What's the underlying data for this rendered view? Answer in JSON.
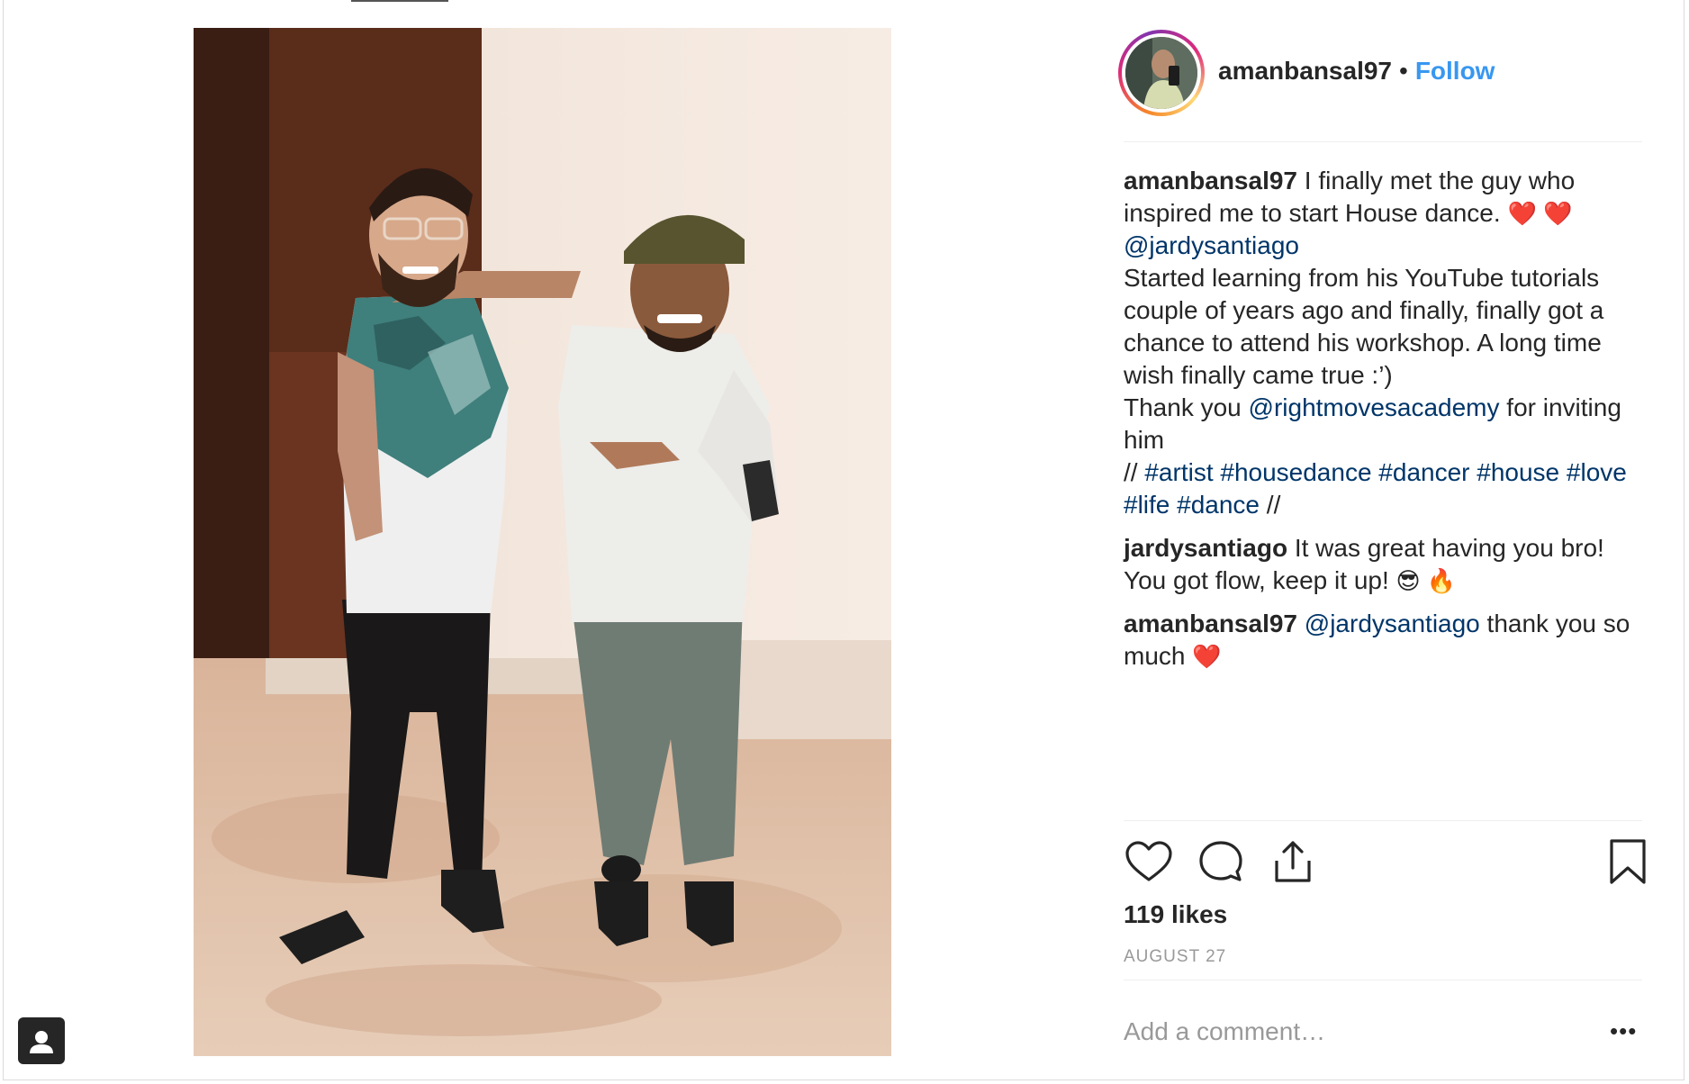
{
  "post": {
    "image_alt": "Two men posing together in a dance studio",
    "user_tag_icon": "person-tag-icon"
  },
  "header": {
    "username": "amanbansal97",
    "separator": "•",
    "follow_label": "Follow"
  },
  "caption": {
    "username": "amanbansal97",
    "text_1": "I finally met the guy who inspired me to start House dance.",
    "hearts": "❤️ ❤️",
    "mention": "@jardysantiago",
    "text_2": "Started learning from his YouTube tutorials couple of years ago and finally, finally got a chance to attend his workshop. A long time wish finally came true :’)",
    "thanks_pre": "Thank you",
    "thanks_mention": "@rightmovesacademy",
    "thanks_post": "for inviting him",
    "tags_pre": "//",
    "tags": "#artist #housedance #dancer #house #love #life #dance",
    "tags_post": "//"
  },
  "comments": [
    {
      "username": "jardysantiago",
      "text": "It was great having you bro! You got flow, keep it up!",
      "emoji": "😎 🔥"
    },
    {
      "username": "amanbansal97",
      "mention": "@jardysantiago",
      "text": "thank you so much",
      "emoji": "❤️"
    }
  ],
  "actions": {
    "like_icon": "heart-icon",
    "comment_icon": "comment-icon",
    "share_icon": "share-icon",
    "save_icon": "bookmark-icon"
  },
  "likes": "119 likes",
  "date": "AUGUST 27",
  "add_comment": {
    "placeholder": "Add a comment…",
    "more": "•••"
  }
}
